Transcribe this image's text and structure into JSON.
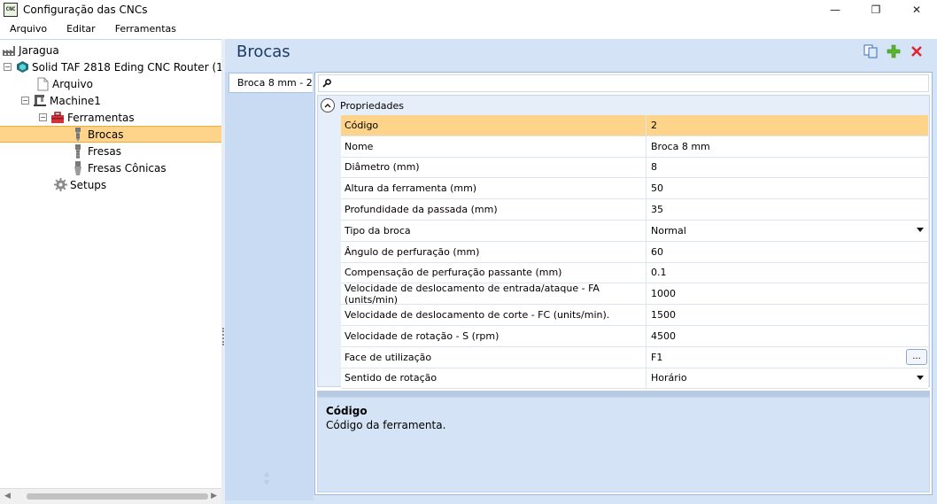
{
  "window": {
    "icon_text": "CNC",
    "title": "Configuração das CNCs",
    "minimize": "—",
    "restore": "❐",
    "close": "✕"
  },
  "menu": [
    "Arquivo",
    "Editar",
    "Ferramentas"
  ],
  "tree": {
    "root": "Jaragua",
    "router": "Solid TAF 2818 Eding CNC Router (1...",
    "arquivo": "Arquivo",
    "machine": "Machine1",
    "ferramentas": "Ferramentas",
    "brocas": "Brocas",
    "fresas": "Fresas",
    "fresas_conicas": "Fresas Cônicas",
    "setups": "Setups"
  },
  "section": {
    "title": "Brocas"
  },
  "tab": {
    "label": "Broca 8 mm - 2"
  },
  "category": {
    "label": "Propriedades"
  },
  "properties": [
    {
      "name": "Código",
      "value": "2"
    },
    {
      "name": "Nome",
      "value": "Broca 8 mm"
    },
    {
      "name": "Diâmetro (mm)",
      "value": "8"
    },
    {
      "name": "Altura da ferramenta (mm)",
      "value": "50"
    },
    {
      "name": "Profundidade da passada (mm)",
      "value": "35"
    },
    {
      "name": "Tipo da broca",
      "value": "Normal"
    },
    {
      "name": "Ângulo de perfuração (mm)",
      "value": "60"
    },
    {
      "name": "Compensação de perfuração passante (mm)",
      "value": "0.1"
    },
    {
      "name": "Velocidade de deslocamento de entrada/ataque - FA (units/min)",
      "value": "1000"
    },
    {
      "name": "Velocidade de deslocamento de corte - FC (units/min).",
      "value": "1500"
    },
    {
      "name": "Velocidade de rotação - S (rpm)",
      "value": "4500"
    },
    {
      "name": "Face de utilização",
      "value": "F1"
    },
    {
      "name": "Sentido de rotação",
      "value": "Horário"
    }
  ],
  "ellipsis_label": "...",
  "description": {
    "title": "Código",
    "text": "Código da ferramenta."
  },
  "colors": {
    "selection": "#fdd48a",
    "panel_bg": "#d4e3f5",
    "title_text": "#1f3b63"
  }
}
